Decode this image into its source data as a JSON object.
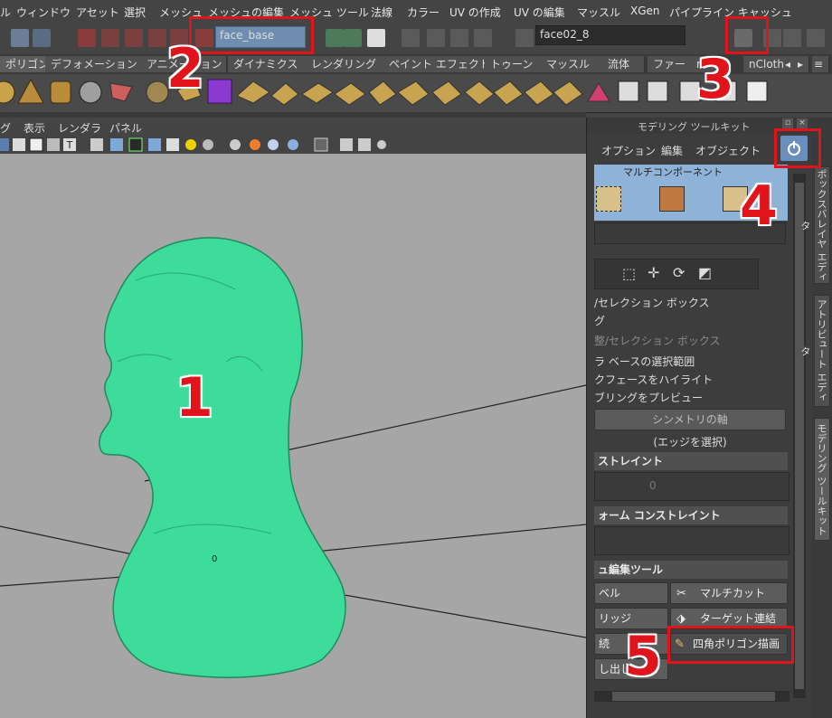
{
  "menubar": {
    "items": [
      "ル",
      "ウィンドウ",
      "アセット",
      "選択",
      "メッシュ",
      "メッシュの編集",
      "メッシュ ツール",
      "法線",
      "カラー",
      "UV の作成",
      "UV の編集",
      "マッスル",
      "XGen",
      "パイプライン キャッシュ"
    ]
  },
  "statusline": {
    "object_name": "face_base",
    "selection_field": "face02_8"
  },
  "shelf": {
    "tabs": [
      "ポリゴン",
      "デフォメーション",
      "アニメーション",
      "ダイナミクス",
      "レンダリング",
      "ペイント エフェクト",
      "トゥーン",
      "マッスル",
      "流体",
      "ファー",
      "n",
      "nCloth"
    ],
    "active_tab": "ポリゴン"
  },
  "viewport": {
    "menu": [
      "グ",
      "表示",
      "レンダラ",
      "パネル"
    ],
    "origin_label": "0"
  },
  "modeling_toolkit": {
    "title": "モデリング ツールキット",
    "menu": [
      "オプション",
      "編集",
      "オブジェクト"
    ],
    "multi_component_label": "マルチコンポーネント",
    "options": [
      "/セレクション ボックス",
      "グ",
      "整/セレクション ボックス",
      "ラ ベースの選択範囲",
      "クフェースをハイライト",
      "ブリングをプレビュー"
    ],
    "symmetry_axis_button": "シンメトリの軸",
    "edge_select_hint": "(エッジを選択)",
    "constraint_section": "ストレイント",
    "constraint_value": "0",
    "transform_constraint_section": "ォーム コンストレイント",
    "mesh_edit_tools_section": "ュ編集ツール",
    "tools_left": [
      "ベル",
      "リッジ",
      "続",
      "し出し"
    ],
    "tools_right": [
      "マルチカット",
      "ターゲット連結",
      "四角ポリゴン描画"
    ]
  },
  "side_tabs": [
    "ポックスバレイヤ エディタ",
    "アトリビュート エディタ",
    "モデリング ツールキット"
  ],
  "annotations": [
    "1",
    "2",
    "3",
    "4",
    "5"
  ],
  "colors": {
    "annotation_red": "#e0141a",
    "mesh_green": "#3ddc9a",
    "viewport_gray": "#a6a6a6",
    "selection_blue": "#8fb3d8"
  }
}
